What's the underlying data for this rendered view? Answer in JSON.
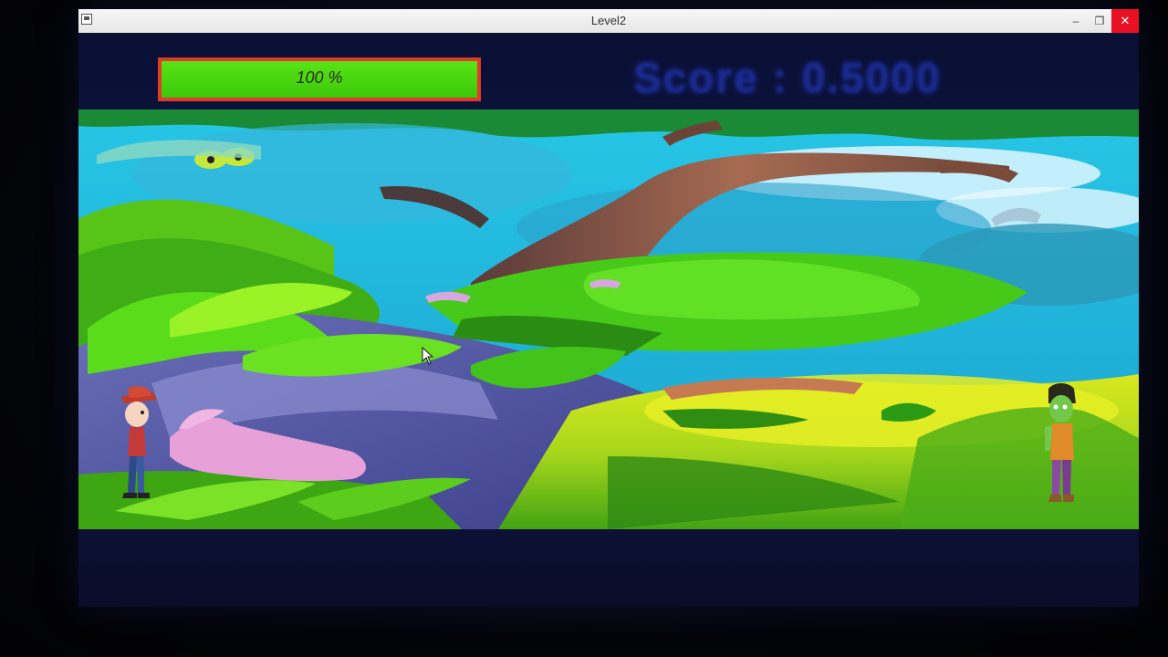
{
  "window": {
    "title": "Level2",
    "minimize_label": "–",
    "maximize_label": "❐",
    "close_label": "✕"
  },
  "hud": {
    "health_text": "100 %",
    "health_value": 1.0,
    "score_text": "Score : 0.5000"
  },
  "colors": {
    "health_fill": "#4fd910",
    "health_border": "#e23a2a",
    "score": "#1b2a8e",
    "close_button": "#e81123"
  },
  "icons": {
    "app": "window-app-icon",
    "cursor": "mouse-pointer-icon"
  }
}
